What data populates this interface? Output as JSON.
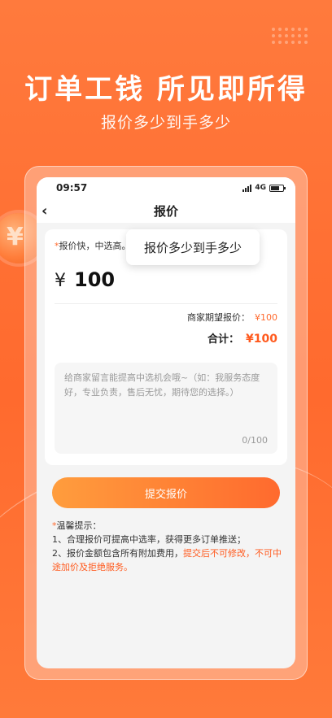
{
  "promo": {
    "headline": "订单工钱 所见即所得",
    "subline": "报价多少到手多少"
  },
  "status_bar": {
    "time": "09:57",
    "network": "4G"
  },
  "nav": {
    "title": "报价",
    "back_icon": "chevron-left-icon"
  },
  "quote_form": {
    "hint_star": "*",
    "hint_text": "报价快，中选高。",
    "tooltip": "报价多少到手多少",
    "currency": "¥",
    "price_value": "100",
    "expected_label": "商家期望报价：",
    "expected_value": "¥100",
    "total_label": "合计：",
    "total_value": "¥100",
    "note_placeholder": "给商家留言能提高中选机会哦~（如：我服务态度好，专业负责，售后无忧，期待您的选择。）",
    "note_count": "0/100"
  },
  "submit_button": {
    "label": "提交报价"
  },
  "tips": {
    "star": "*",
    "title": "温馨提示：",
    "line1": "1、合理报价可提高中选率，获得更多订单推送；",
    "line2_prefix": "2、报价金额包含所有附加费用，",
    "line2_highlight": "提交后不可修改，不可中途加价及拒绝服务。"
  },
  "colors": {
    "accent": "#ff6a2e",
    "button_start": "#ff9d3d",
    "button_end": "#ff6a2e"
  }
}
